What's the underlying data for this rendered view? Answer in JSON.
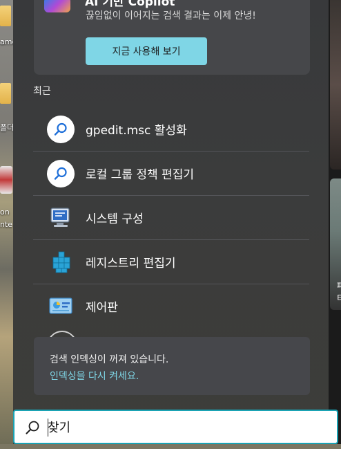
{
  "desktop": {
    "left_labels": [
      "amd",
      "폴더",
      "on",
      "nte"
    ],
    "right_labels": [
      "패",
      "티"
    ]
  },
  "copilot": {
    "title": "AI 기반 Copilot",
    "description": "끊임없이 이어지는 검색 결과는 이제 안녕!",
    "button_label": "지금 사용해 보기"
  },
  "recent": {
    "heading": "최근",
    "items": [
      {
        "label": "gpedit.msc 활성화",
        "icon": "search-icon"
      },
      {
        "label": "로컬 그룹 정책 편집기",
        "icon": "search-icon"
      },
      {
        "label": "시스템 구성",
        "icon": "system-config-icon"
      },
      {
        "label": "레지스트리 편집기",
        "icon": "registry-editor-icon"
      },
      {
        "label": "제어판",
        "icon": "control-panel-icon"
      }
    ]
  },
  "notice": {
    "text": "검색 인덱싱이 꺼져 있습니다.",
    "link": "인덱싱을 다시 켜세요."
  },
  "search": {
    "placeholder": "찾기",
    "value": ""
  },
  "colors": {
    "accent": "#7fd6e6",
    "search_border": "#1aa3b4",
    "panel_bg": "#3a3b3c"
  }
}
